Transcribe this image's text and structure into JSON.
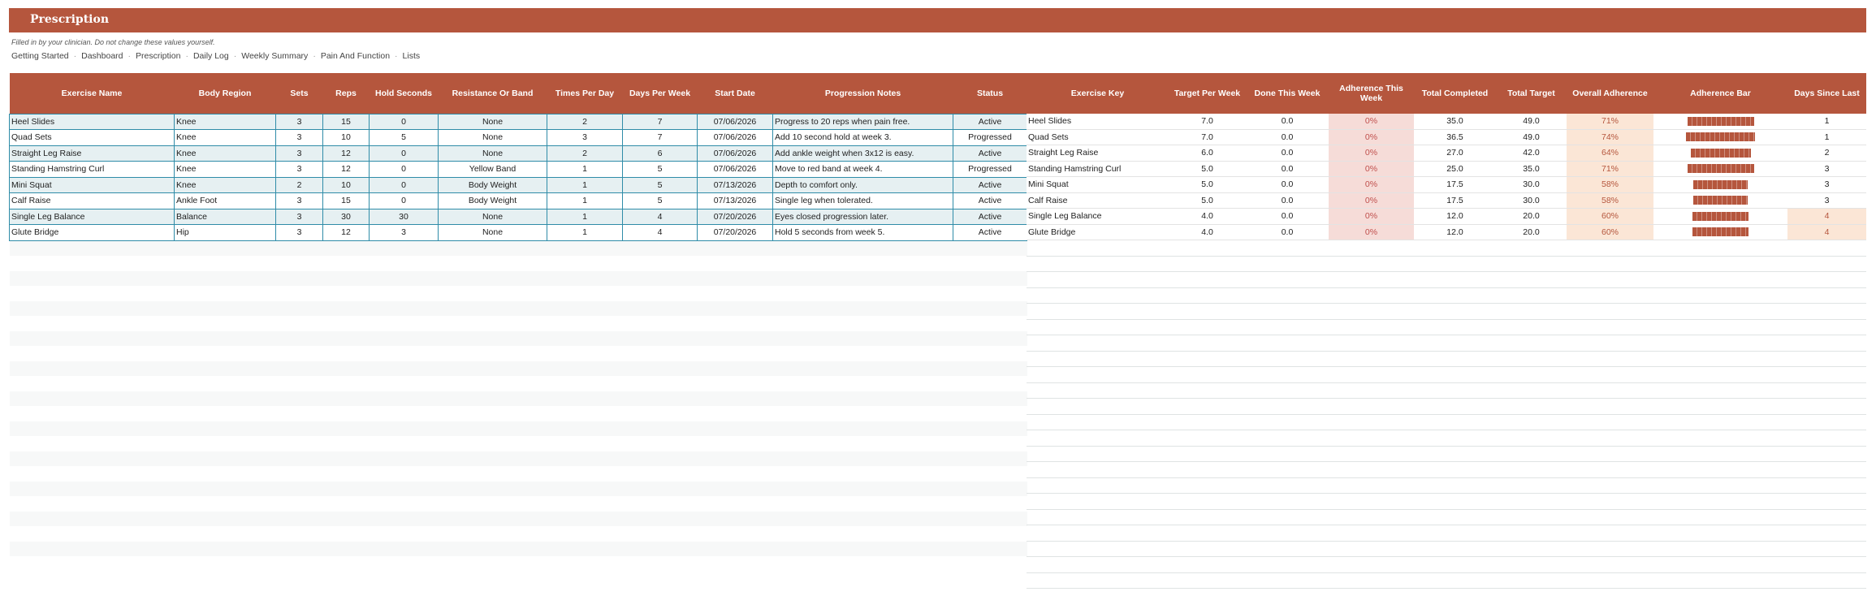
{
  "header": {
    "title": "Prescription",
    "subtitle": "Filled in by your clinician. Do not change these values yourself."
  },
  "nav": [
    "Getting Started",
    "Dashboard",
    "Prescription",
    "Daily Log",
    "Weekly Summary",
    "Pain And Function",
    "Lists"
  ],
  "colors": {
    "header": "#b5563d",
    "border": "#2f8ca8",
    "row_band": "#e6f0f2",
    "adherence_week_bg": "#f6dcd8",
    "adherence_overall_bg": "#fbe6d6"
  },
  "prescription": {
    "columns": [
      "Exercise Name",
      "Body Region",
      "Sets",
      "Reps",
      "Hold Seconds",
      "Resistance Or Band",
      "Times Per Day",
      "Days Per Week",
      "Start Date",
      "Progression Notes",
      "Status"
    ],
    "rows": [
      [
        "Heel Slides",
        "Knee",
        "3",
        "15",
        "0",
        "None",
        "2",
        "7",
        "07/06/2026",
        "Progress to 20 reps when pain free.",
        "Active"
      ],
      [
        "Quad Sets",
        "Knee",
        "3",
        "10",
        "5",
        "None",
        "3",
        "7",
        "07/06/2026",
        "Add 10 second hold at week 3.",
        "Progressed"
      ],
      [
        "Straight Leg Raise",
        "Knee",
        "3",
        "12",
        "0",
        "None",
        "2",
        "6",
        "07/06/2026",
        "Add ankle weight when 3x12 is easy.",
        "Active"
      ],
      [
        "Standing Hamstring Curl",
        "Knee",
        "3",
        "12",
        "0",
        "Yellow Band",
        "1",
        "5",
        "07/06/2026",
        "Move to red band at week 4.",
        "Progressed"
      ],
      [
        "Mini Squat",
        "Knee",
        "2",
        "10",
        "0",
        "Body Weight",
        "1",
        "5",
        "07/13/2026",
        "Depth to comfort only.",
        "Active"
      ],
      [
        "Calf Raise",
        "Ankle Foot",
        "3",
        "15",
        "0",
        "Body Weight",
        "1",
        "5",
        "07/13/2026",
        "Single leg when tolerated.",
        "Active"
      ],
      [
        "Single Leg Balance",
        "Balance",
        "3",
        "30",
        "30",
        "None",
        "1",
        "4",
        "07/20/2026",
        "Eyes closed progression later.",
        "Active"
      ],
      [
        "Glute Bridge",
        "Hip",
        "3",
        "12",
        "3",
        "None",
        "1",
        "4",
        "07/20/2026",
        "Hold 5 seconds from week 5.",
        "Active"
      ]
    ]
  },
  "summary": {
    "columns": [
      "Exercise Key",
      "Target Per Week",
      "Done This Week",
      "Adherence This Week",
      "Total Completed",
      "Total Target",
      "Overall Adherence",
      "Adherence Bar",
      "Days Since Last"
    ],
    "rows": [
      {
        "key": "Heel Slides",
        "target": "7.0",
        "done": "0.0",
        "week": "0%",
        "completed": "35.0",
        "total": "49.0",
        "overall": "71%",
        "bar": 0.71,
        "days": "1",
        "warn": false
      },
      {
        "key": "Quad Sets",
        "target": "7.0",
        "done": "0.0",
        "week": "0%",
        "completed": "36.5",
        "total": "49.0",
        "overall": "74%",
        "bar": 0.74,
        "days": "1",
        "warn": false
      },
      {
        "key": "Straight Leg Raise",
        "target": "6.0",
        "done": "0.0",
        "week": "0%",
        "completed": "27.0",
        "total": "42.0",
        "overall": "64%",
        "bar": 0.64,
        "days": "2",
        "warn": false
      },
      {
        "key": "Standing Hamstring Curl",
        "target": "5.0",
        "done": "0.0",
        "week": "0%",
        "completed": "25.0",
        "total": "35.0",
        "overall": "71%",
        "bar": 0.71,
        "days": "3",
        "warn": false
      },
      {
        "key": "Mini Squat",
        "target": "5.0",
        "done": "0.0",
        "week": "0%",
        "completed": "17.5",
        "total": "30.0",
        "overall": "58%",
        "bar": 0.58,
        "days": "3",
        "warn": false
      },
      {
        "key": "Calf Raise",
        "target": "5.0",
        "done": "0.0",
        "week": "0%",
        "completed": "17.5",
        "total": "30.0",
        "overall": "58%",
        "bar": 0.58,
        "days": "3",
        "warn": false
      },
      {
        "key": "Single Leg Balance",
        "target": "4.0",
        "done": "0.0",
        "week": "0%",
        "completed": "12.0",
        "total": "20.0",
        "overall": "60%",
        "bar": 0.6,
        "days": "4",
        "warn": true
      },
      {
        "key": "Glute Bridge",
        "target": "4.0",
        "done": "0.0",
        "week": "0%",
        "completed": "12.0",
        "total": "20.0",
        "overall": "60%",
        "bar": 0.6,
        "days": "4",
        "warn": true
      }
    ]
  }
}
